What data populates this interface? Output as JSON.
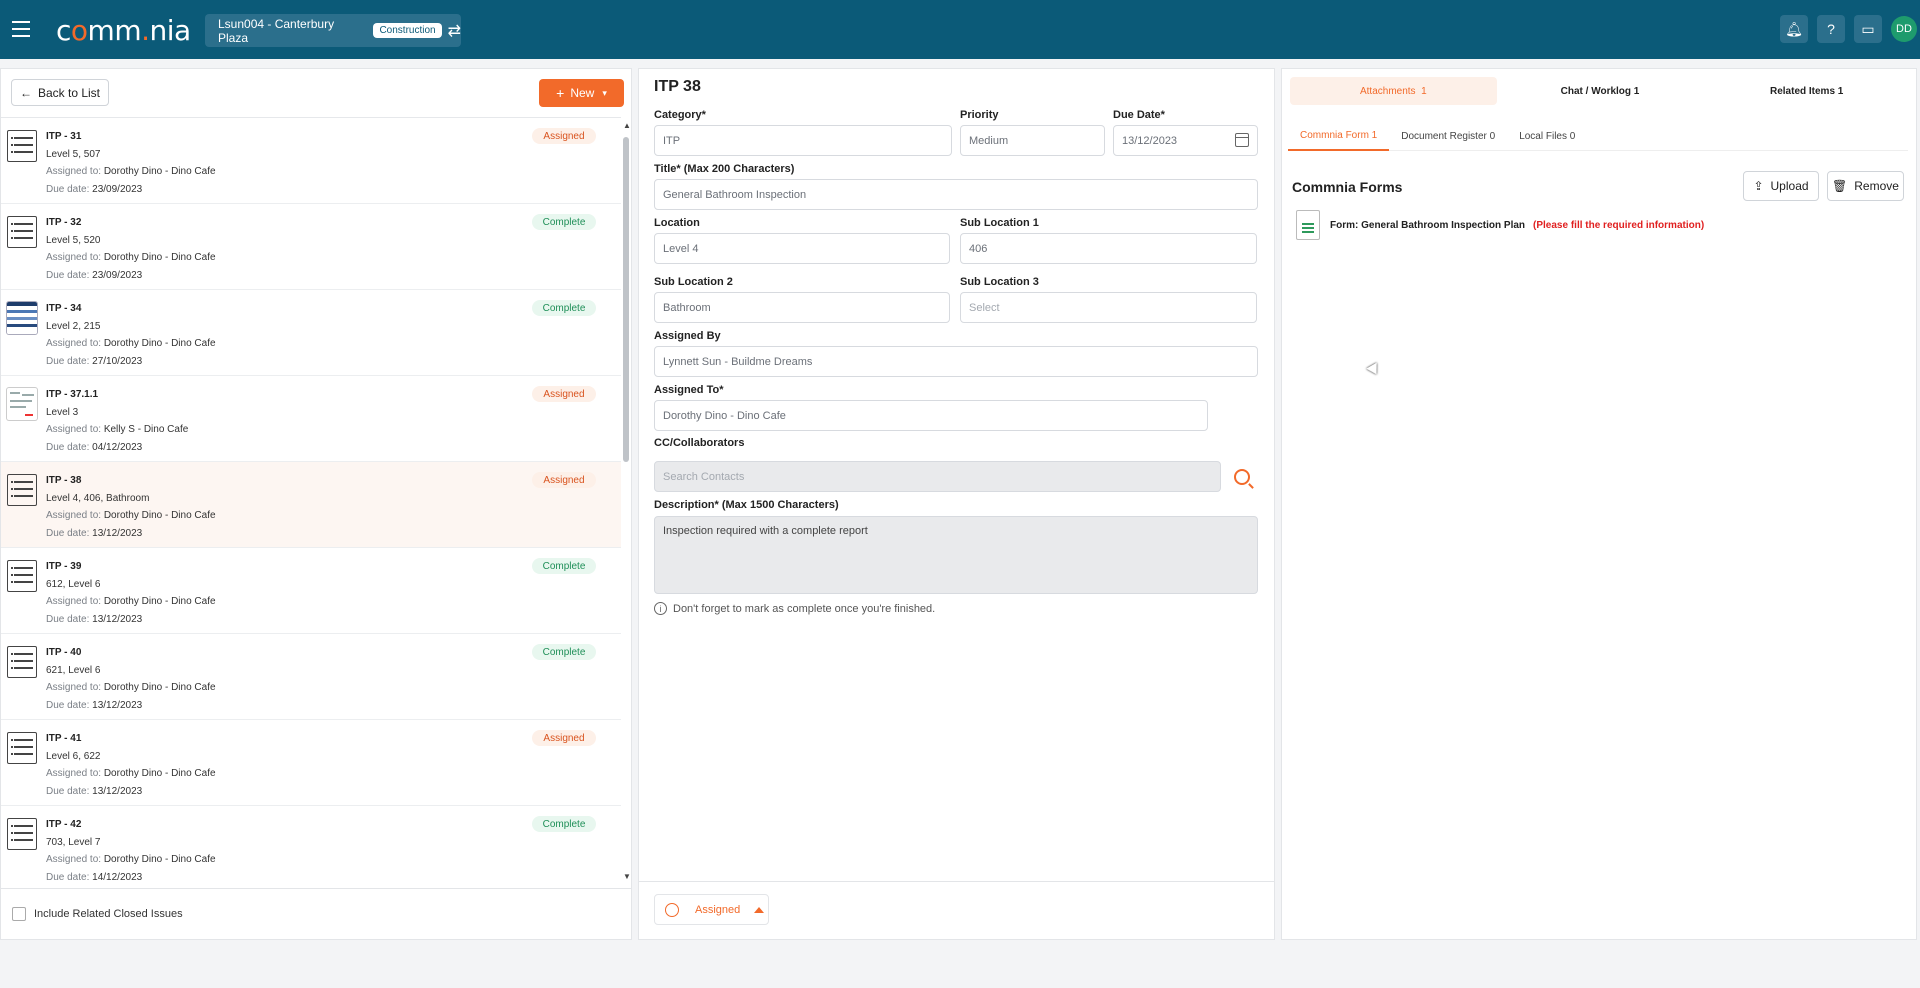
{
  "header": {
    "logo_a": "c",
    "logo_b": "mm",
    "logo_c": "nia",
    "project": "Lsun004 - Canterbury Plaza",
    "project_badge": "Construction",
    "avatar": "DD"
  },
  "left": {
    "back_label": "Back to List",
    "new_label": "New",
    "assigned_key": "Assigned to:",
    "due_key": "Due date:",
    "items": [
      {
        "title": "ITP - 31",
        "location": "Level 5, 507",
        "assignee": "Dorothy Dino - Dino Cafe",
        "due": "23/09/2023",
        "status": "Assigned"
      },
      {
        "title": "ITP - 32",
        "location": "Level 5, 520",
        "assignee": "Dorothy Dino - Dino Cafe",
        "due": "23/09/2023",
        "status": "Complete"
      },
      {
        "title": "ITP - 34",
        "location": "Level 2, 215",
        "assignee": "Dorothy Dino - Dino Cafe",
        "due": "27/10/2023",
        "status": "Complete"
      },
      {
        "title": "ITP - 37.1.1",
        "location": "Level 3",
        "assignee": "Kelly S - Dino Cafe",
        "due": "04/12/2023",
        "status": "Assigned"
      },
      {
        "title": "ITP - 38",
        "location": "Level 4, 406, Bathroom",
        "assignee": "Dorothy Dino - Dino Cafe",
        "due": "13/12/2023",
        "status": "Assigned"
      },
      {
        "title": "ITP - 39",
        "location": "612, Level 6",
        "assignee": "Dorothy Dino - Dino Cafe",
        "due": "13/12/2023",
        "status": "Complete"
      },
      {
        "title": "ITP - 40",
        "location": "621, Level 6",
        "assignee": "Dorothy Dino - Dino Cafe",
        "due": "13/12/2023",
        "status": "Complete"
      },
      {
        "title": "ITP - 41",
        "location": "Level 6, 622",
        "assignee": "Dorothy Dino - Dino Cafe",
        "due": "13/12/2023",
        "status": "Assigned"
      },
      {
        "title": "ITP - 42",
        "location": "703, Level 7",
        "assignee": "Dorothy Dino - Dino Cafe",
        "due": "14/12/2023",
        "status": "Complete"
      }
    ],
    "include_closed_label": "Include Related Closed Issues"
  },
  "detail": {
    "title": "ITP 38",
    "category_label": "Category*",
    "category_value": "ITP",
    "priority_label": "Priority",
    "priority_value": "Medium",
    "due_label": "Due Date*",
    "due_value": "13/12/2023",
    "title_label": "Title* (Max 200 Characters)",
    "title_value": "General Bathroom Inspection",
    "location_label": "Location",
    "location_value": "Level 4",
    "sub1_label": "Sub Location 1",
    "sub1_value": "406",
    "sub2_label": "Sub Location 2",
    "sub2_value": "Bathroom",
    "sub3_label": "Sub Location 3",
    "sub3_placeholder": "Select",
    "assigned_by_label": "Assigned By",
    "assigned_by_value": "Lynnett Sun - Buildme Dreams",
    "assigned_to_label": "Assigned To*",
    "assigned_to_value": "Dorothy Dino - Dino Cafe",
    "cc_label": "CC/Collaborators",
    "cc_placeholder": "Search Contacts",
    "desc_label": "Description* (Max 1500 Characters)",
    "desc_value": "Inspection required with a complete report",
    "hint": "Don't forget to mark as complete once you're finished.",
    "status_button": "Assigned"
  },
  "right": {
    "tabs": [
      "Attachments",
      "Chat / Worklog 1",
      "Related Items 1"
    ],
    "attachments_count": "1",
    "subtabs": [
      "Commnia Form 1",
      "Document Register 0",
      "Local Files 0"
    ],
    "section_title": "Commnia Forms",
    "upload_label": "Upload",
    "remove_label": "Remove",
    "form_name": "Form: General Bathroom Inspection Plan",
    "form_warning": "(Please fill the required information)"
  },
  "colors": {
    "accent": "#f26a2a",
    "header": "#0b5a78",
    "complete": "#1f8f58"
  }
}
